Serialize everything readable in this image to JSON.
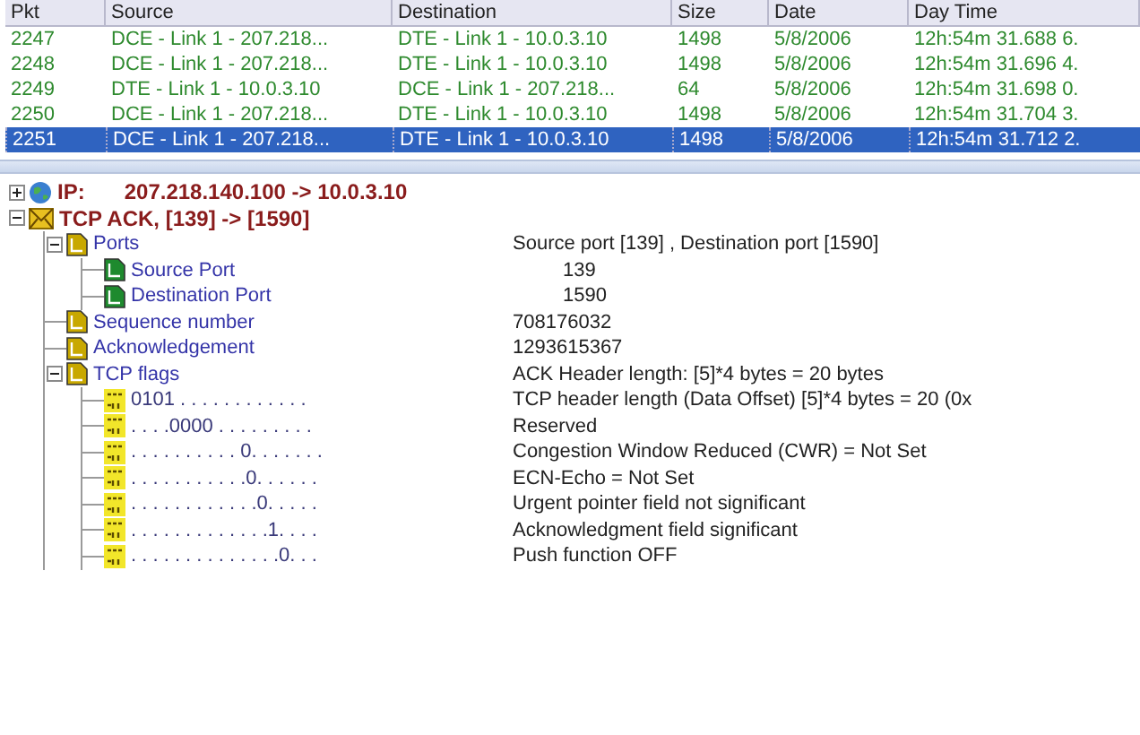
{
  "packet_table": {
    "columns": [
      "Pkt",
      "Source",
      "Destination",
      "Size",
      "Date",
      "Day Time"
    ],
    "rows": [
      {
        "selected": false,
        "cells": [
          "2247",
          "DCE - Link 1 - 207.218...",
          "DTE - Link 1 - 10.0.3.10",
          "1498",
          "5/8/2006",
          "12h:54m 31.688 6."
        ]
      },
      {
        "selected": false,
        "cells": [
          "2248",
          "DCE - Link 1 - 207.218...",
          "DTE - Link 1 - 10.0.3.10",
          "1498",
          "5/8/2006",
          "12h:54m 31.696 4."
        ]
      },
      {
        "selected": false,
        "cells": [
          "2249",
          "DTE - Link 1 - 10.0.3.10",
          "DCE - Link 1 - 207.218...",
          "64",
          "5/8/2006",
          "12h:54m 31.698 0."
        ]
      },
      {
        "selected": false,
        "cells": [
          "2250",
          "DCE - Link 1 - 207.218...",
          "DTE - Link 1 - 10.0.3.10",
          "1498",
          "5/8/2006",
          "12h:54m 31.704 3."
        ]
      },
      {
        "selected": true,
        "cells": [
          "2251",
          "DCE - Link 1 - 207.218...",
          "DTE - Link 1 - 10.0.3.10",
          "1498",
          "5/8/2006",
          "12h:54m 31.712 2."
        ]
      }
    ]
  },
  "decode_tree": [
    {
      "kind": "layer",
      "label": "IP:",
      "detail": "207.218.140.100 -> 10.0.3.10",
      "expanded": false
    },
    {
      "kind": "layer",
      "label": "TCP ACK,  [139]  -> [1590]",
      "expanded": true,
      "children": [
        {
          "kind": "field",
          "label": "Ports",
          "value": "Source port [139] , Destination port [1590]",
          "expanded": true,
          "children": [
            {
              "kind": "subfield",
              "label": "Source Port",
              "value": "139"
            },
            {
              "kind": "subfield",
              "label": "Destination Port",
              "value": "1590"
            }
          ]
        },
        {
          "kind": "field",
          "label": "Sequence number",
          "value": "708176032"
        },
        {
          "kind": "field",
          "label": "Acknowledgement",
          "value": "1293615367"
        },
        {
          "kind": "field",
          "label": "TCP flags",
          "value": "ACK   Header length: [5]*4 bytes = 20 bytes",
          "expanded": true,
          "children": [
            {
              "kind": "bits",
              "label": "0101 . . . . . . . . . . . .",
              "value": "TCP header length (Data Offset) [5]*4 bytes = 20 (0x"
            },
            {
              "kind": "bits",
              "label": ". . . .0000 . . . . . . . . .",
              "value": "Reserved"
            },
            {
              "kind": "bits",
              "label": ". . . . . . . . . . 0. . . . . . .",
              "value": "Congestion Window Reduced (CWR) = Not Set"
            },
            {
              "kind": "bits",
              "label": ". . . . . . . . . . .0. . . . . .",
              "value": "ECN-Echo = Not Set"
            },
            {
              "kind": "bits",
              "label": ". . . . . . . . . . . .0. . . . .",
              "value": "Urgent pointer field not significant"
            },
            {
              "kind": "bits",
              "label": ". . . . . . . . . . . . .1. . . .",
              "value": "Acknowledgment field significant"
            },
            {
              "kind": "bits",
              "label": ". . . . . . . . . . . . . .0. . .",
              "value": "Push function OFF"
            }
          ]
        }
      ]
    }
  ]
}
